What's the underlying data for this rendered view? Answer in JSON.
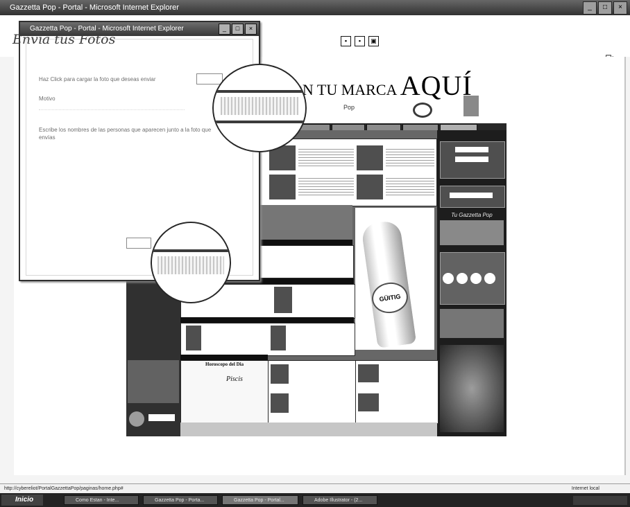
{
  "browser": {
    "title": "Gazzetta Pop - Portal - Microsoft Internet Explorer",
    "status_url": "http://cybereliot/PortalGazzettaPop/paginas/home.php#",
    "status_zone": "Internet local"
  },
  "site": {
    "slogan_prefix": "ON TU MARCA",
    "slogan_main": "AQUÍ",
    "gazzetta_label": "Tu Gazzetta Pop",
    "horoscope_title": "Horoscopo del Dia",
    "horoscope_sign": "Piscis",
    "bottle_brand": "GÜITIG"
  },
  "popup": {
    "window_title": "Gazzetta Pop - Portal - Microsoft Internet Explorer",
    "heading": "Envía tus Fotos",
    "upload_label": "Haz Click para cargar la foto que deseas enviar",
    "motivo_label": "Motivo",
    "names_label": "Escribe los nombres de las personas que aparecen junto a la foto que envías"
  },
  "taskbar": {
    "start_label": "Inicio",
    "tasks": [
      "Como Estan - Inte...",
      "Gazzetta Pop - Porta...",
      "Gazzetta Pop - Portal...",
      "Adobe Illustrator - (2..."
    ]
  }
}
